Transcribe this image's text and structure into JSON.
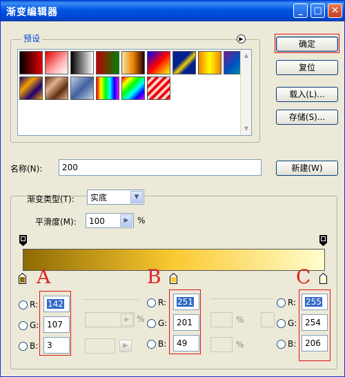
{
  "window": {
    "title": "渐变编辑器",
    "controls": [
      "minimize-icon",
      "maximize-icon",
      "close-icon"
    ]
  },
  "presets": {
    "label": "预设",
    "menu_icon": "arrow-right-circle-icon",
    "swatches": [
      "linear-gradient(90deg,#000,#e00000)",
      "linear-gradient(135deg,#e00000 0%,#ffb0b0 60%,#fff 100%)",
      "linear-gradient(90deg,#000,#fff)",
      "linear-gradient(90deg,#c00000,#008000)",
      "linear-gradient(90deg,#f2e6a0,#f08000,#200000)",
      "linear-gradient(135deg,#0000ff,#ff0000,#ffff00)",
      "linear-gradient(135deg,#002090 0%,#002090 40%,#f0d000 55%,#002090 70%)",
      "linear-gradient(90deg,#f08000,#ffff00,#f08000)",
      "linear-gradient(135deg,#702090,#0050c0,#00a0a0)",
      "linear-gradient(135deg,#200070,#f0a000,#200070,#f0a000)",
      "linear-gradient(135deg,#603010,#e0b090,#603010,#e0b090)",
      "linear-gradient(135deg,#c0d0e0,#4060a0,#c0d0e0)",
      "linear-gradient(90deg,#ff0000,#ffff00,#00ff00,#00ffff,#0000ff,#ff00ff)",
      "linear-gradient(135deg,#ff0000,#ffff00,#00ff00,#00ffff,#0000ff,#ff00ff)",
      "repeating-linear-gradient(135deg,#f00000 0px,#f00000 4px,#ffd0d0 4px,#ffd0d0 8px)"
    ]
  },
  "buttons": {
    "ok": "确定",
    "reset": "复位",
    "load": "载入(L)...",
    "save": "存储(S)...",
    "new": "新建(W)"
  },
  "name": {
    "label": "名称(N):",
    "value": "200"
  },
  "gradient": {
    "type_label": "渐变类型(T):",
    "type_value": "实底",
    "smoothness_label": "平滑度(M):",
    "smoothness_value": "100",
    "percent": "%",
    "bar": "linear-gradient(90deg,#8e6b03 0%,#fbc931 50%,#fffece 100%)"
  },
  "stops": [
    {
      "letter": "A",
      "r": "142",
      "g": "107",
      "b": "3",
      "color": "#8e6b03"
    },
    {
      "letter": "B",
      "r": "251",
      "g": "201",
      "b": "49",
      "color": "#fbc931"
    },
    {
      "letter": "C",
      "r": "255",
      "g": "254",
      "b": "206",
      "color": "#fffece"
    }
  ],
  "channel_labels": {
    "r": "R:",
    "g": "G:",
    "b": "B:"
  },
  "colors": {
    "title_bar": "#0054e3",
    "face": "#ece9d8",
    "selection": "#316ac5",
    "highlight_box": "#e01010"
  }
}
